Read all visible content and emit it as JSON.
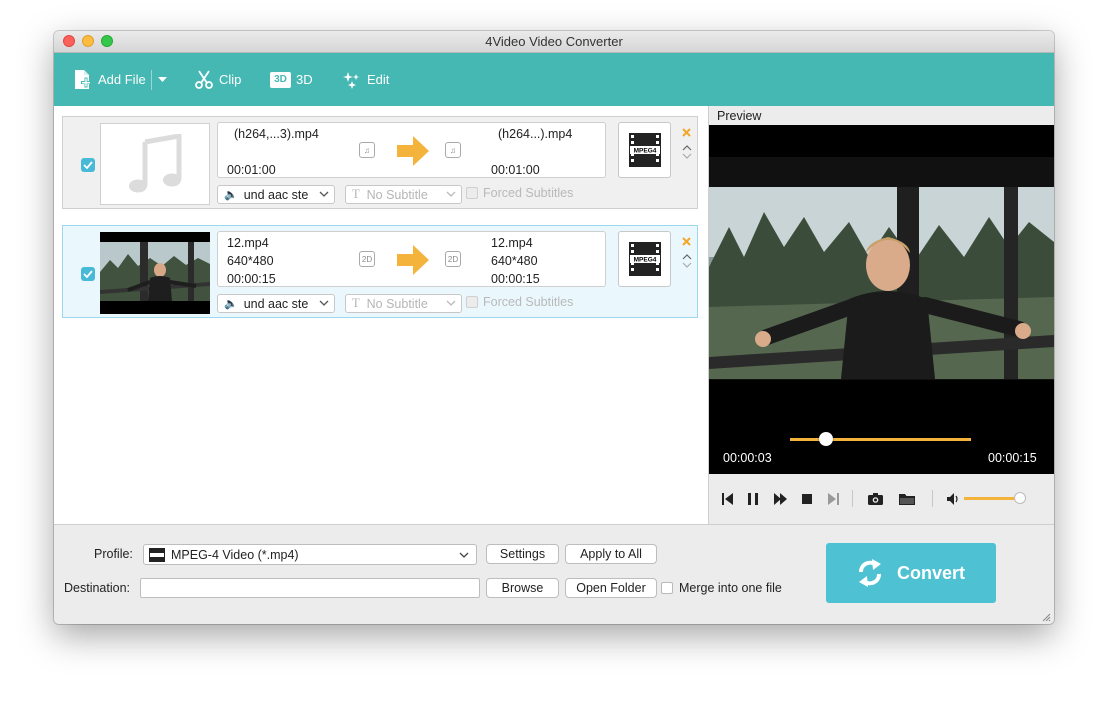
{
  "window": {
    "title": "4Video Video Converter"
  },
  "toolbar": {
    "add_file": "Add File",
    "clip": "Clip",
    "three_d": "3D",
    "three_d_badge": "3D",
    "edit": "Edit"
  },
  "files": [
    {
      "source_name": "(h264,...3).mp4",
      "source_duration": "00:01:00",
      "target_name": "(h264...).mp4",
      "target_duration": "00:01:00",
      "audio_track": "und aac ste",
      "subtitle": "No Subtitle",
      "forced_subtitles": "Forced Subtitles",
      "checked": true
    },
    {
      "source_name": "12.mp4",
      "source_resolution": "640*480",
      "source_duration": "00:00:15",
      "badge": "2D",
      "target_name": "12.mp4",
      "target_resolution": "640*480",
      "target_duration": "00:00:15",
      "audio_track": "und aac ste",
      "subtitle": "No Subtitle",
      "forced_subtitles": "Forced Subtitles",
      "checked": true
    }
  ],
  "format_badge": "MPEG4",
  "preview": {
    "label": "Preview",
    "current_time": "00:00:03",
    "total_time": "00:00:15",
    "progress": 0.2,
    "volume": 0.9
  },
  "bottom": {
    "profile_label": "Profile:",
    "profile_value": "MPEG-4 Video (*.mp4)",
    "settings": "Settings",
    "apply_to_all": "Apply to All",
    "destination_label": "Destination:",
    "destination_value": "",
    "browse": "Browse",
    "open_folder": "Open Folder",
    "merge": "Merge into one file",
    "convert": "Convert"
  },
  "colors": {
    "toolbar": "#45b8b3",
    "accent_orange": "#f4b43c",
    "convert": "#4ec1d2",
    "checkbox": "#48b9d6"
  }
}
